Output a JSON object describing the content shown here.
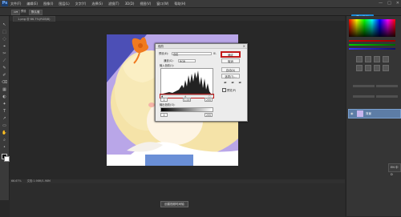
{
  "app": {
    "logo": "Ps"
  },
  "menubar": {
    "items": [
      "文件(F)",
      "编辑(E)",
      "图像(I)",
      "图层(L)",
      "文字(Y)",
      "选择(S)",
      "滤镜(T)",
      "3D(D)",
      "视图(V)",
      "窗口(W)",
      "帮助(H)"
    ],
    "win_controls": [
      "—",
      "□",
      "✕"
    ]
  },
  "optionsbar": {
    "preset_label": "预设",
    "preset_value": "默认值"
  },
  "workspace": {
    "essentials_label": "基本功能"
  },
  "document_tab": {
    "label": "1.png @ 66.7%(RGB/8)"
  },
  "levels_dialog": {
    "title": "色阶",
    "preset_label": "预设(E):",
    "preset_value": "自定",
    "channel_label": "通道(C):",
    "channel_value": "RGB",
    "input_label": "输入色阶(I):",
    "input_black": "0",
    "input_mid": "1.00",
    "input_white": "255",
    "output_label": "输出色阶(O):",
    "output_black": "0",
    "output_white": "255",
    "buttons": {
      "ok": "确定",
      "cancel": "取消",
      "auto": "自动(A)",
      "options": "选项(T)...",
      "preview": "预览(P)"
    }
  },
  "statusbar": {
    "zoom": "66.67%",
    "doc": "文档:1.98M/1.98M"
  },
  "timeline": {
    "create_label": "创建视频时间轴"
  },
  "layers": {
    "layer_name": "背景"
  },
  "tooltip": {
    "text": "EN 中 D"
  }
}
